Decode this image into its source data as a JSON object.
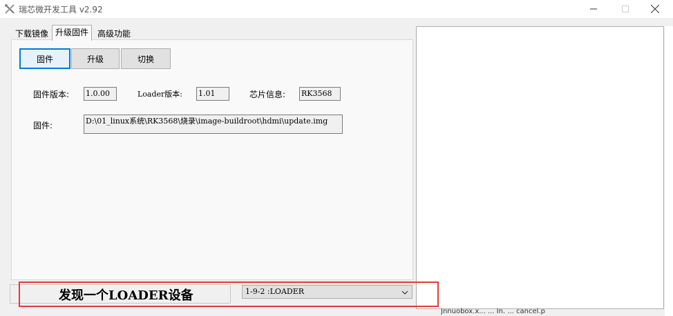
{
  "window": {
    "title": "瑞芯微开发工具 v2.92"
  },
  "tabs": [
    {
      "label": "下载镜像"
    },
    {
      "label": "升级固件"
    },
    {
      "label": "高级功能"
    }
  ],
  "actions": {
    "firmware": "固件",
    "upgrade": "升级",
    "switch": "切换"
  },
  "info": {
    "fw_version_label": "固件版本:",
    "fw_version": "1.0.00",
    "loader_version_label": "Loader版本:",
    "loader_version": "1.01",
    "chip_label": "芯片信息:",
    "chip": "RK3568",
    "firmware_label": "固件:",
    "firmware_path": "D:\\01_linux系统\\RK3568\\烧录\\image-buildroot\\hdmi\\update.img"
  },
  "status": {
    "message": "发现一个LOADER设备",
    "device": "1-9-2 :LOADER"
  },
  "background_window": {
    "fragment": "Jnnuobox.x... ... In. ... cancel.p"
  },
  "colors": {
    "accent": "#0078d7",
    "highlight": "#e53935"
  }
}
